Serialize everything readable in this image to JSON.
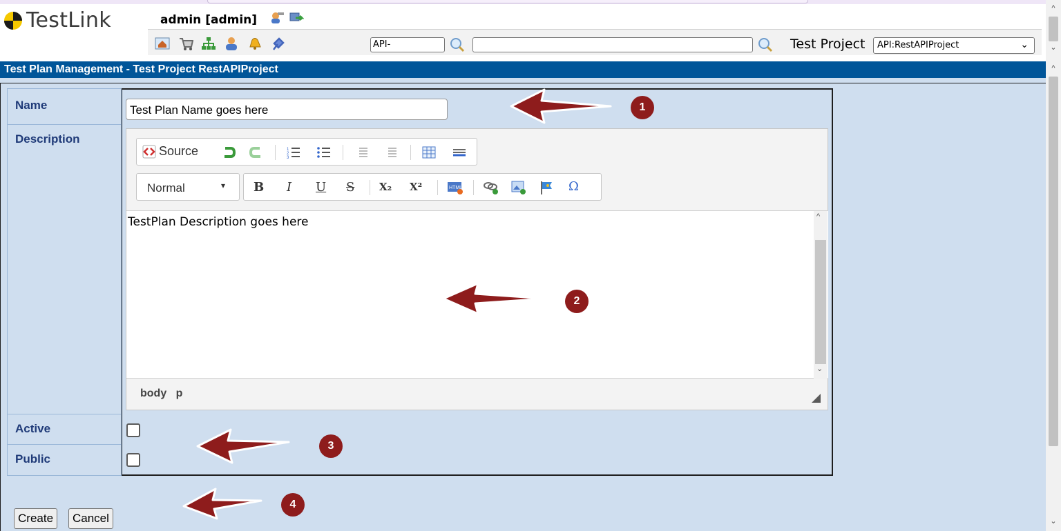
{
  "app": {
    "logo_text": "TestLink",
    "user_label": "admin [admin]"
  },
  "toolbar": {
    "icons": [
      "home-icon",
      "cart-icon",
      "tree-icon",
      "user-icon",
      "bell-icon",
      "plug-icon"
    ],
    "search_prefix_value": "API-",
    "search_value": "",
    "project_label": "Test Project",
    "project_selected": "API:RestAPIProject"
  },
  "page": {
    "title": "Test Plan Management - Test Project RestAPIProject"
  },
  "form": {
    "name_label": "Name",
    "name_value": "Test Plan Name goes here",
    "description_label": "Description",
    "active_label": "Active",
    "public_label": "Public",
    "create_label": "Create",
    "cancel_label": "Cancel"
  },
  "editor": {
    "source_label": "Source",
    "format_selected": "Normal",
    "bold_label": "B",
    "italic_label": "I",
    "underline_label": "U",
    "strike_label": "S",
    "subscript_label": "X₂",
    "superscript_label": "X²",
    "omega_label": "Ω",
    "content": "TestPlan Description goes here",
    "path_body": "body",
    "path_p": "p"
  },
  "annotations": {
    "badge_1": "1",
    "badge_2": "2",
    "badge_3": "3",
    "badge_4": "4",
    "color": "#8e1c1c"
  },
  "colors": {
    "title_bar": "#005599",
    "content_bg": "#cfdeef",
    "label_text": "#1f3a78"
  }
}
